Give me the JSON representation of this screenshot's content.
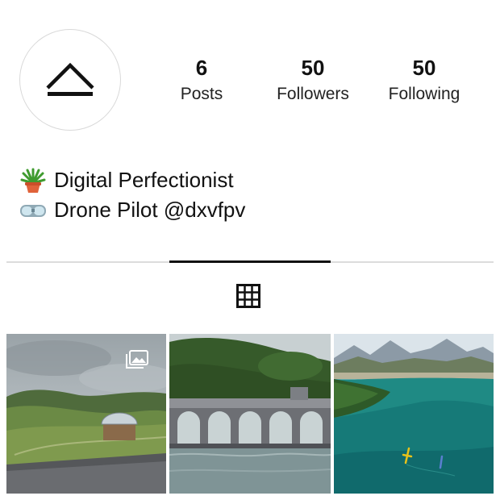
{
  "avatar": {
    "icon": "collapse-up-icon"
  },
  "stats": [
    {
      "value": "6",
      "label": "Posts"
    },
    {
      "value": "50",
      "label": "Followers"
    },
    {
      "value": "50",
      "label": "Following"
    }
  ],
  "bio": {
    "line1": {
      "icon": "potted-plant-emoji",
      "text": "Digital Perfectionist"
    },
    "line2": {
      "icon": "goggles-emoji",
      "text": "Drone Pilot @dxvfpv"
    }
  },
  "tabs": {
    "grid_icon": "grid-icon"
  },
  "posts": [
    {
      "kind": "album",
      "icon": "multiple-photos-icon"
    },
    {
      "kind": "photo"
    },
    {
      "kind": "photo"
    }
  ]
}
